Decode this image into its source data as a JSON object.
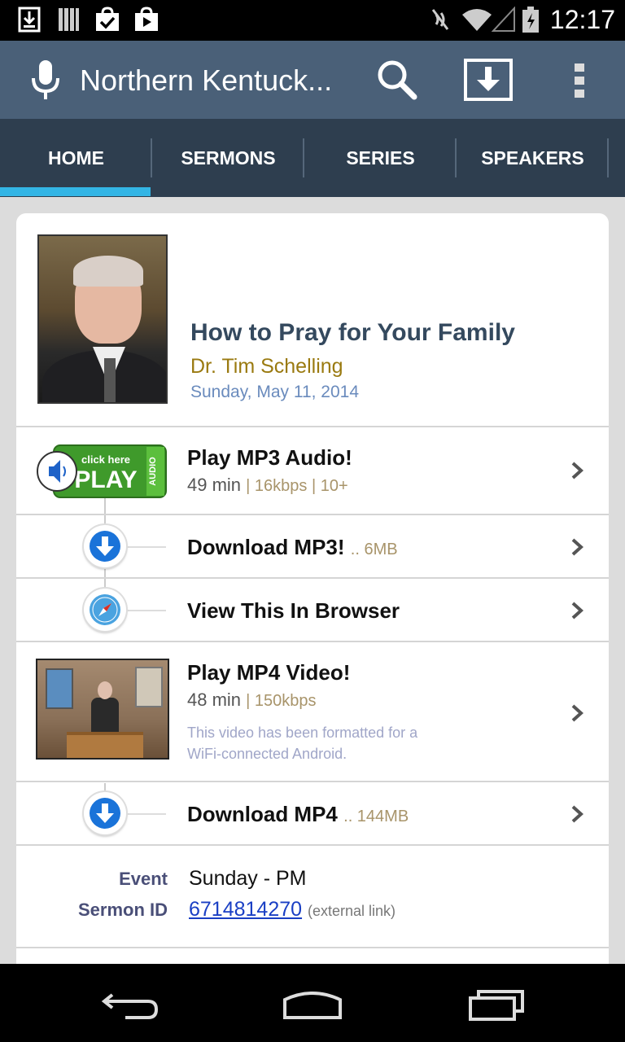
{
  "status_bar": {
    "time": "12:17",
    "icons": [
      "download-notification-icon",
      "library-icon",
      "bag-check-icon",
      "play-store-icon",
      "mute-icon",
      "wifi-icon",
      "signal-icon",
      "battery-icon"
    ]
  },
  "action_bar": {
    "title": "Northern Kentuck...",
    "icons": [
      "microphone-icon",
      "search-icon",
      "download-icon",
      "overflow-menu-icon"
    ]
  },
  "tabs": [
    {
      "label": "HOME",
      "active": true
    },
    {
      "label": "SERMONS",
      "active": false
    },
    {
      "label": "SERIES",
      "active": false
    },
    {
      "label": "SPEAKERS",
      "active": false
    }
  ],
  "accent_color": "#33b5e5",
  "sermon": {
    "title": "How to Pray for Your Family",
    "speaker": "Dr. Tim Schelling",
    "date": "Sunday, May 11, 2014"
  },
  "rows": {
    "play_mp3": {
      "label": "Play MP3 Audio!",
      "duration": "49 min",
      "meta": "| 16kbps | 10+",
      "badge_text": "click here PLAY AUDIO"
    },
    "download_mp3": {
      "label": "Download MP3!",
      "size": ".. 6MB"
    },
    "browser": {
      "label": "View This In Browser"
    },
    "play_mp4": {
      "label": "Play MP4 Video!",
      "duration": "48 min",
      "meta": "| 150kbps",
      "note": "This video has been formatted for a WiFi-connected Android."
    },
    "download_mp4": {
      "label": "Download MP4",
      "size": ".. 144MB"
    }
  },
  "details": {
    "event_label": "Event",
    "event_value": "Sunday - PM",
    "sermon_id_label": "Sermon ID",
    "sermon_id_value": "6714814270",
    "external_note": "(external link)"
  }
}
